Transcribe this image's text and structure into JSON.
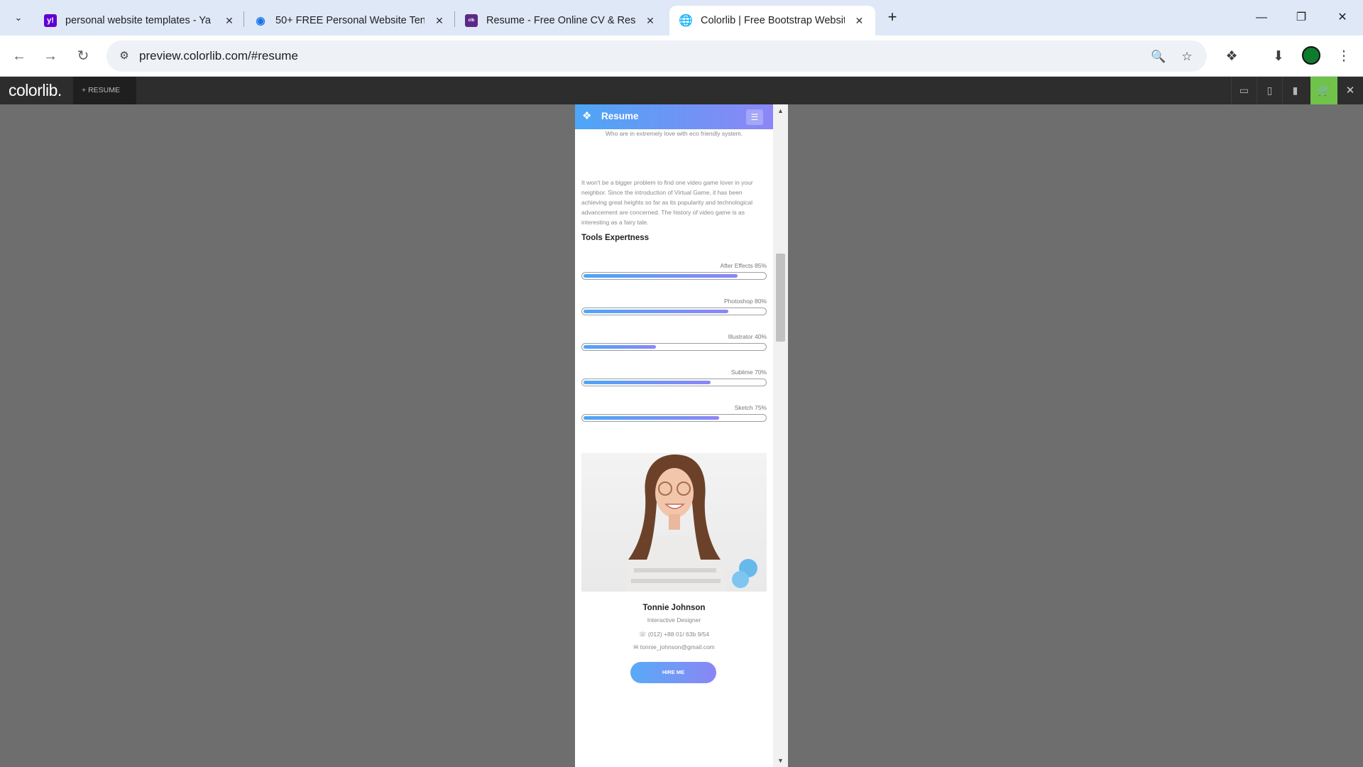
{
  "browser": {
    "tabs": [
      {
        "title": "personal website templates - Ya",
        "favicon": "yahoo-icon",
        "color": "#6001d2"
      },
      {
        "title": "50+ FREE Personal Website Ten",
        "favicon": "eye-icon",
        "color": "#1a73e8"
      },
      {
        "title": "Resume - Free Online CV & Res",
        "favicon": "colorlib-icon",
        "color": "#5b2a86"
      },
      {
        "title": "Colorlib | Free Bootstrap Websit",
        "favicon": "globe-icon",
        "color": "#5f6368",
        "active": true
      }
    ],
    "url": "preview.colorlib.com/#resume"
  },
  "preview_bar": {
    "logo": "colorlib.",
    "template_select": "RESUME",
    "accent": "#6fc34a"
  },
  "site": {
    "brand": "Resume",
    "tagline": "Who are in extremely love with eco friendly system.",
    "paragraph": "It won't be a bigger problem to find one video game lover in your neighbor. Since the introduction of Virtual Game, it has been achieving great heights so far as its popularity and technological advancement are concerned. The history of video game is as interesting as a fairy tale.",
    "tools_title": "Tools Expertness",
    "skills": [
      {
        "label": "After Effects 85%",
        "value": 85
      },
      {
        "label": "Photoshop 80%",
        "value": 80
      },
      {
        "label": "Illustrator 40%",
        "value": 40
      },
      {
        "label": "Sublime 70%",
        "value": 70
      },
      {
        "label": "Sketch 75%",
        "value": 75
      }
    ],
    "profile": {
      "name": "Tonnie Johnson",
      "role": "Interactive Designer",
      "phone": "(012) +88 01/ 63b 9/54",
      "email": "tonnie_johnson@gmail.com",
      "cta": "HIRE ME"
    },
    "gradient": [
      "#4da6f6",
      "#8c86f6"
    ]
  }
}
